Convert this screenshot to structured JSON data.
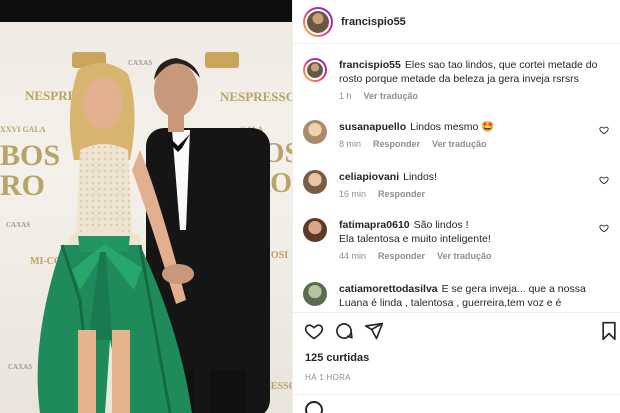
{
  "post": {
    "username": "francispio55",
    "caption": "Eles sao tao lindos, que cortei metade do rosto porque metade da beleza ja gera inveja rsrsrs",
    "caption_time": "1 h",
    "caption_translate": "Ver tradução",
    "likes": "125 curtidas",
    "posted_ago": "HÁ 1 HORA"
  },
  "photo": {
    "backdrop_words": [
      "NESPRESSO",
      "NESPRESSO",
      "CAXAS",
      "XXVI GALA",
      "BOS",
      "RO",
      "GALA",
      "BOS",
      "RO",
      "CAXAS",
      "CAXAS",
      "NESPRESSO",
      "MI-COSI",
      "MI-COSI"
    ]
  },
  "comments": [
    {
      "user": "susanapuello",
      "text": "Lindos mesmo 🤩",
      "time": "8 min",
      "reply": "Responder",
      "translate": "Ver tradução"
    },
    {
      "user": "celiapiovani",
      "text": "Lindos!",
      "time": "16 min",
      "reply": "Responder",
      "translate": ""
    },
    {
      "user": "fatimapra0610",
      "text": "São lindos !",
      "text2": "Ela talentosa e muito inteligente!",
      "time": "44 min",
      "reply": "Responder",
      "translate": "Ver tradução"
    },
    {
      "user": "catiamorettodasilva",
      "text": "E se gera inveja... que a nossa Luana é linda , talentosa , guerreira,tem voz e é espetacular."
    }
  ],
  "icons": [
    "heart-icon",
    "comment-icon",
    "share-icon",
    "bookmark-icon",
    "smiley-icon"
  ],
  "colors": {
    "story_ring_start": "#f9ce34",
    "story_ring_mid": "#ee2a7b",
    "story_ring_end": "#6228d7",
    "dress_green": "#1f8a5a",
    "tux_black": "#141414"
  }
}
